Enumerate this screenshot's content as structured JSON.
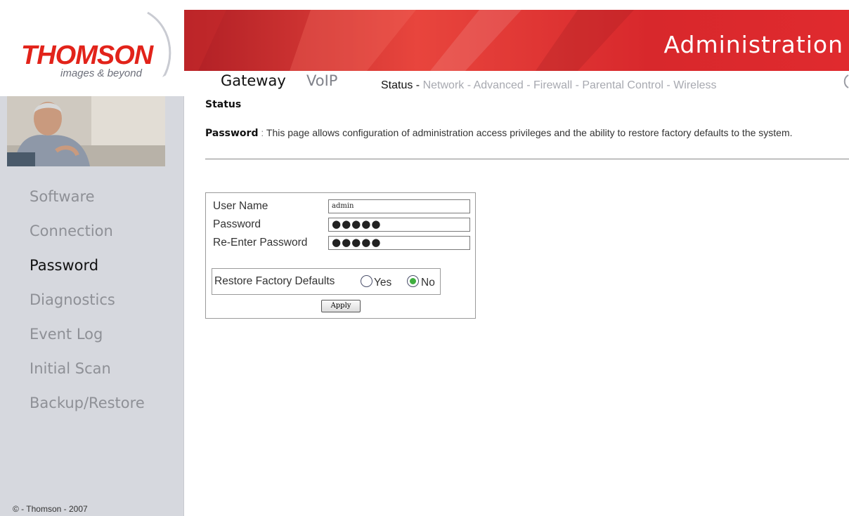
{
  "brand": {
    "logo": "THOMSON",
    "tagline": "images & beyond",
    "accent_color": "#e2231a"
  },
  "header": {
    "title": "Administration",
    "tabs": [
      "Gateway",
      "VoIP"
    ],
    "active_tab": "Gateway",
    "subnav": {
      "status": "Status -",
      "network": "Network -",
      "advanced": "Advanced -",
      "firewall": "Firewall -",
      "parental": "Parental Control -",
      "wireless": "Wireless"
    }
  },
  "sidebar": {
    "items": [
      "Software",
      "Connection",
      "Password",
      "Diagnostics",
      "Event Log",
      "Initial Scan",
      "Backup/Restore"
    ],
    "active_item": "Password",
    "copyright": "© - Thomson - 2007"
  },
  "content": {
    "section_title": "Status",
    "description_label": "Password",
    "description_sep": " : ",
    "description_text": "This page allows configuration of administration access privileges and the ability to restore factory defaults to the system.",
    "form": {
      "username_label": "User Name",
      "username_value": "admin",
      "password_label": "Password",
      "password_value": "●●●●●",
      "reenter_label": "Re-Enter Password",
      "reenter_value": "●●●●●",
      "restore_label": "Restore Factory Defaults",
      "yes_label": "Yes",
      "no_label": "No",
      "restore_selected": "No",
      "apply_label": "Apply"
    }
  }
}
